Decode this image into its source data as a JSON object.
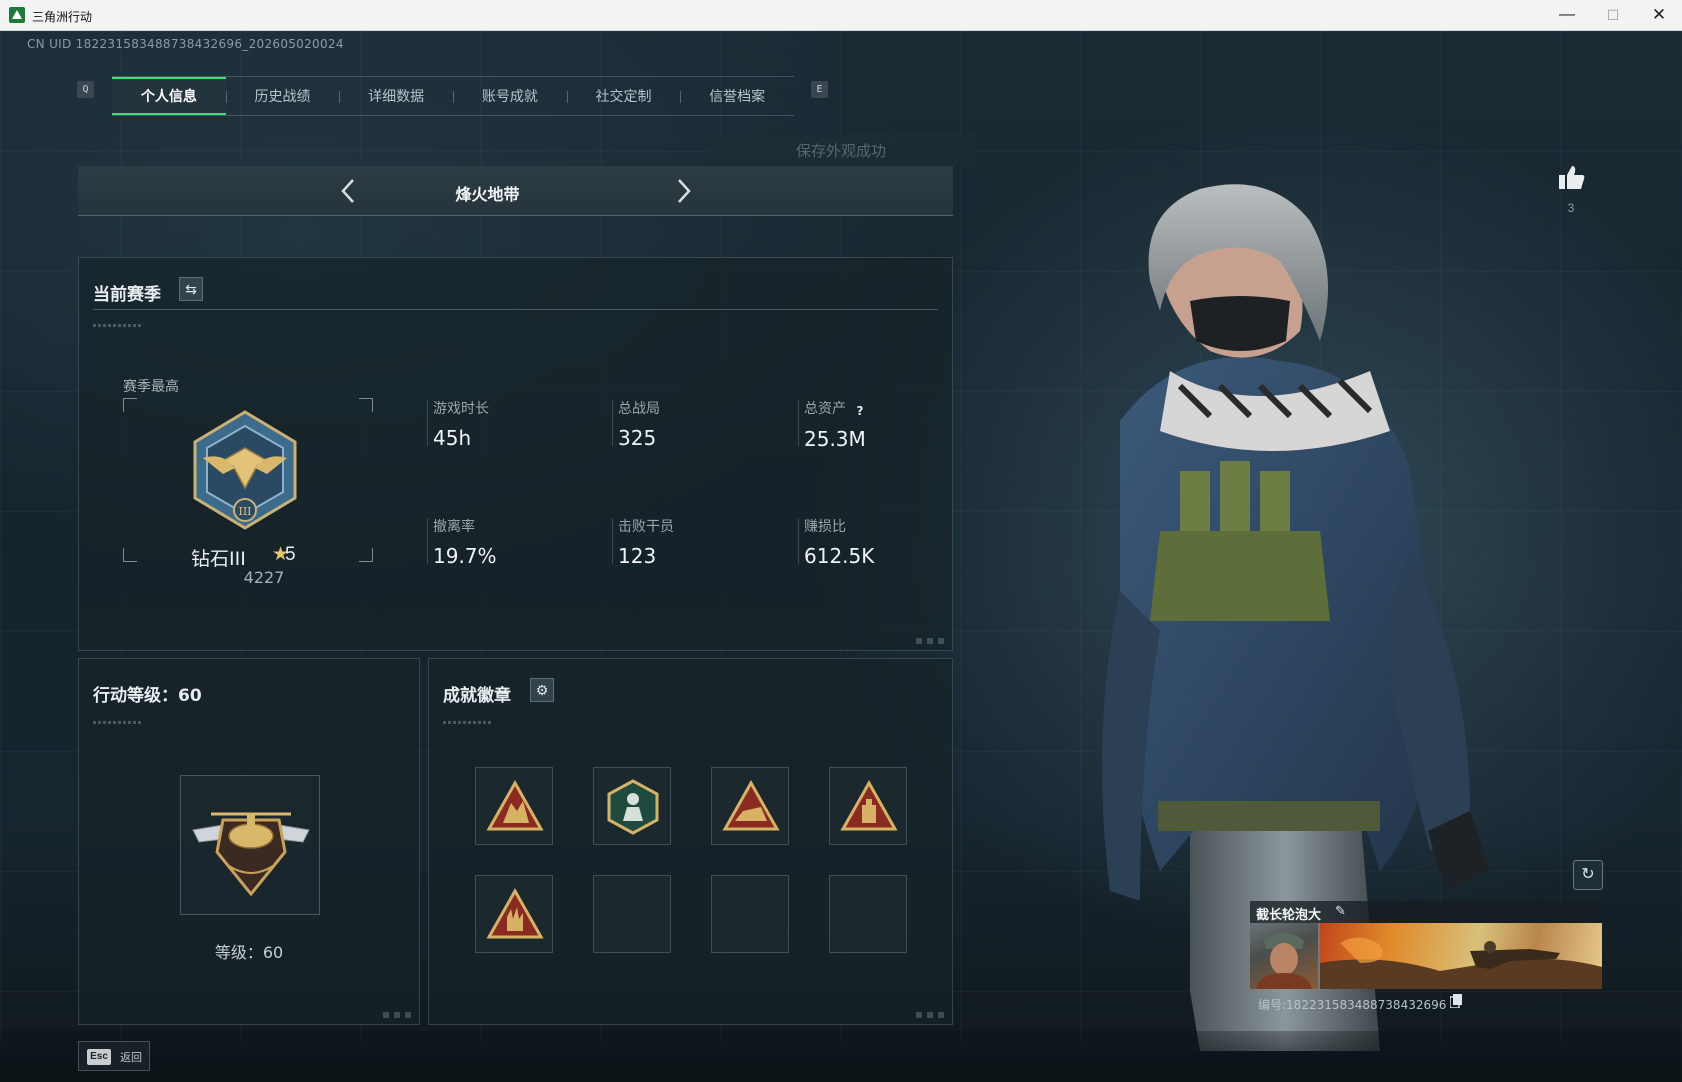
{
  "window": {
    "title": "三角洲行动",
    "min_icon": "minimize-icon",
    "max_icon": "maximize-icon",
    "close_icon": "close-icon"
  },
  "uid_line": "CN UID 18223158348873843269​6_202605020024",
  "tabs": {
    "prev_key": "Q",
    "next_key": "E",
    "items": [
      {
        "label": "个人信息",
        "active": true
      },
      {
        "label": "历史战绩",
        "active": false
      },
      {
        "label": "详细数据",
        "active": false
      },
      {
        "label": "账号成就",
        "active": false
      },
      {
        "label": "社交定制",
        "active": false
      },
      {
        "label": "信誉档案",
        "active": false
      }
    ]
  },
  "toast": "保存外观成功",
  "mode": {
    "title": "烽火地带",
    "prev_icon": "chevron-left-icon",
    "next_icon": "chevron-right-icon"
  },
  "season": {
    "title": "当前赛季",
    "swap_icon": "swap-icon",
    "best_label": "赛季最高",
    "rank_name": "钻石III",
    "rank_stars": "5",
    "rank_score": "4227",
    "stats": [
      {
        "label": "游戏时长",
        "value": "45h"
      },
      {
        "label": "总战局",
        "value": "325"
      },
      {
        "label": "总资产",
        "value": "25.3M",
        "help": "?"
      },
      {
        "label": "撤离率",
        "value": "19.7%"
      },
      {
        "label": "击败干员",
        "value": "123"
      },
      {
        "label": "赚损比",
        "value": "612.5K"
      }
    ]
  },
  "level": {
    "title": "行动等级：60",
    "level_text": "等级：60"
  },
  "badges": {
    "title": "成就徽章",
    "settings_icon": "gear-icon",
    "slots": [
      {
        "filled": true,
        "icon": "triangle-badge-icon"
      },
      {
        "filled": true,
        "icon": "hexagon-badge-icon"
      },
      {
        "filled": true,
        "icon": "triangle-badge-icon"
      },
      {
        "filled": true,
        "icon": "triangle-badge-icon"
      },
      {
        "filled": true,
        "icon": "triangle-badge-icon"
      },
      {
        "filled": false
      },
      {
        "filled": false
      },
      {
        "filled": false
      }
    ]
  },
  "profile": {
    "like_count": "3",
    "name": "截长轮泡大",
    "id_line": "编号:18223158348873843269​6"
  },
  "footer": {
    "esc_key": "Esc",
    "back_label": "返回"
  },
  "colors": {
    "accent": "#3fe07e",
    "gold": "#d7b264",
    "badge_red": "#8a2b22"
  }
}
